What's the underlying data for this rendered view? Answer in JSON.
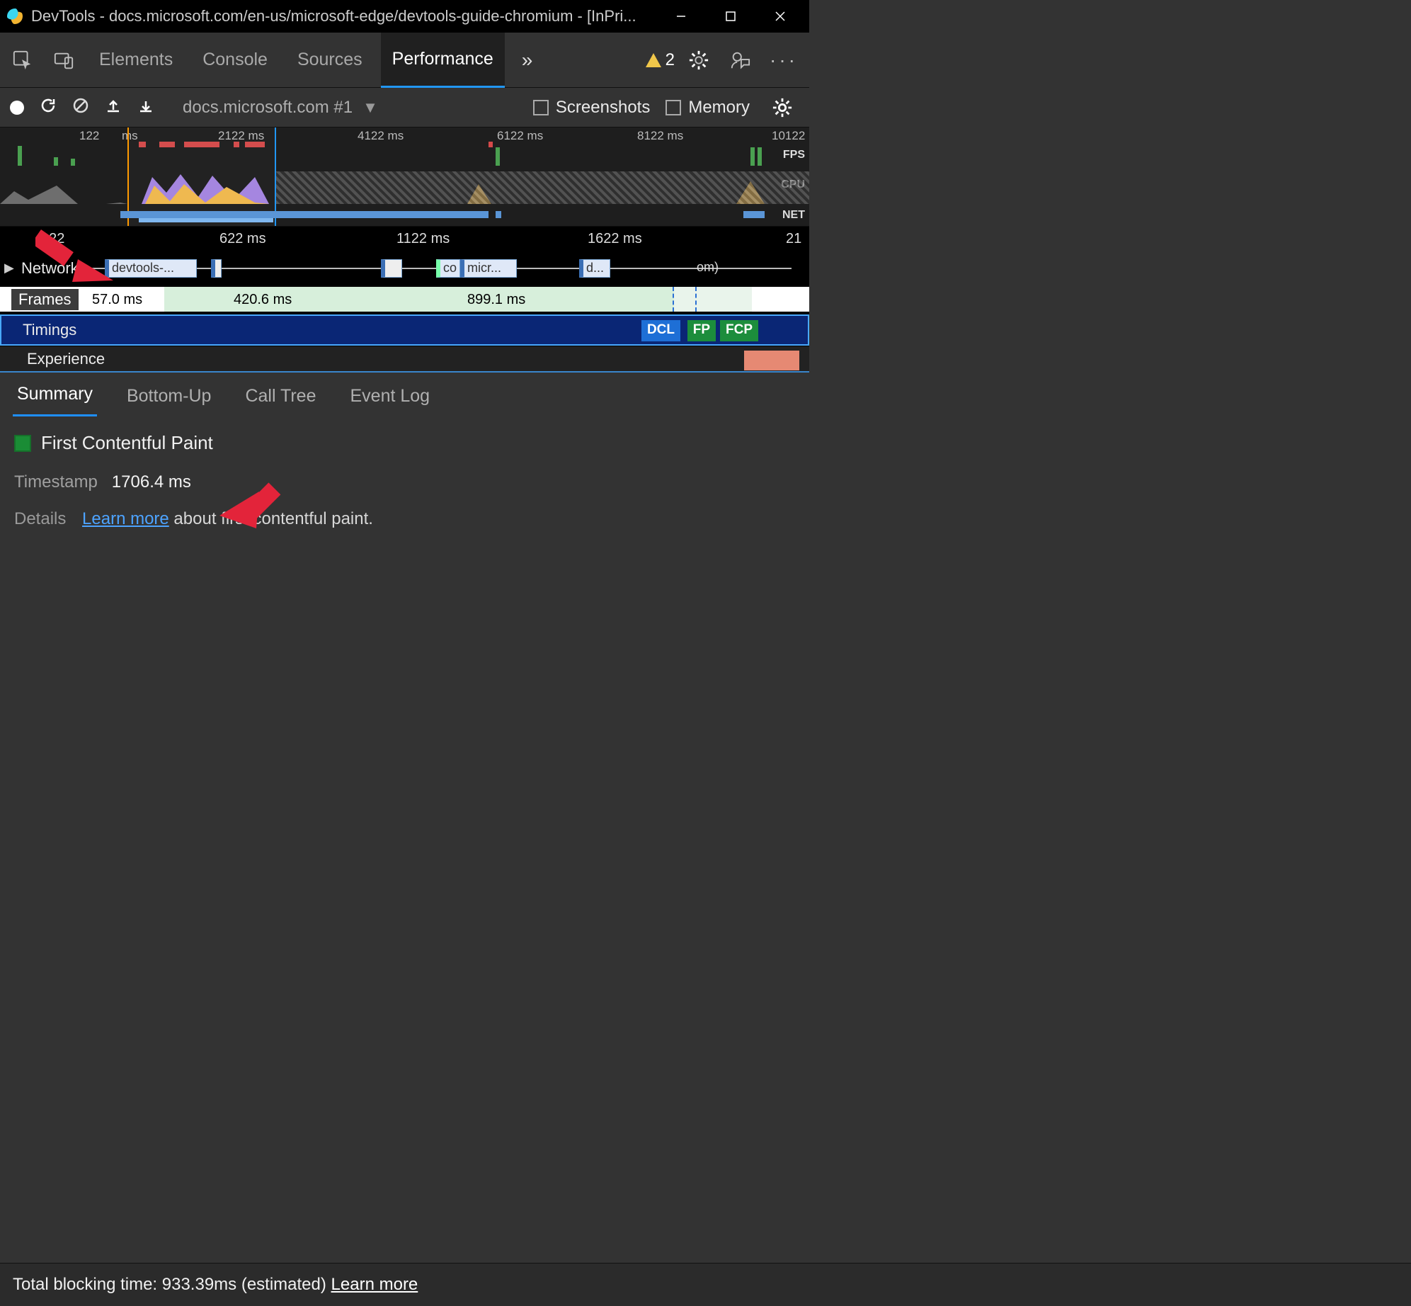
{
  "window": {
    "title": "DevTools - docs.microsoft.com/en-us/microsoft-edge/devtools-guide-chromium - [InPri..."
  },
  "main_tabs": {
    "elements": "Elements",
    "console": "Console",
    "sources": "Sources",
    "performance": "Performance",
    "more": "»",
    "warning_count": "2"
  },
  "toolbar": {
    "recording_label": "docs.microsoft.com #1",
    "screenshots_label": "Screenshots",
    "memory_label": "Memory"
  },
  "overview_ticks": {
    "t1": "122",
    "t1s": "ms",
    "t2": "2122 ms",
    "t3": "4122 ms",
    "t4": "6122 ms",
    "t5": "8122 ms",
    "t6": "10122",
    "fps": "FPS",
    "cpu": "CPU",
    "net": "NET"
  },
  "ruler": {
    "r1": "122",
    "r2": "622 ms",
    "r3": "1122 ms",
    "r4": "1622 ms",
    "r5": "21"
  },
  "rows": {
    "network": "Network",
    "net_items": {
      "a": "devtools-...",
      "b": "co",
      "c": "micr...",
      "d": "d...",
      "e": "om)"
    },
    "frames": "Frames",
    "frame_txt": {
      "a": "57.0 ms",
      "b": "420.6 ms",
      "c": "899.1 ms"
    },
    "timings": "Timings",
    "timing_badges": {
      "dcl": "DCL",
      "fp": "FP",
      "fcp": "FCP"
    },
    "experience": "Experience"
  },
  "bottom_tabs": {
    "summary": "Summary",
    "bottomup": "Bottom-Up",
    "calltree": "Call Tree",
    "eventlog": "Event Log"
  },
  "summary": {
    "title": "First Contentful Paint",
    "timestamp_label": "Timestamp",
    "timestamp_value": "1706.4 ms",
    "details_label": "Details",
    "learn_more": "Learn more",
    "details_tail": " about first contentful paint."
  },
  "footer": {
    "prefix": "Total blocking time: ",
    "value": "933.39ms (estimated) ",
    "learn_more": "Learn more"
  }
}
